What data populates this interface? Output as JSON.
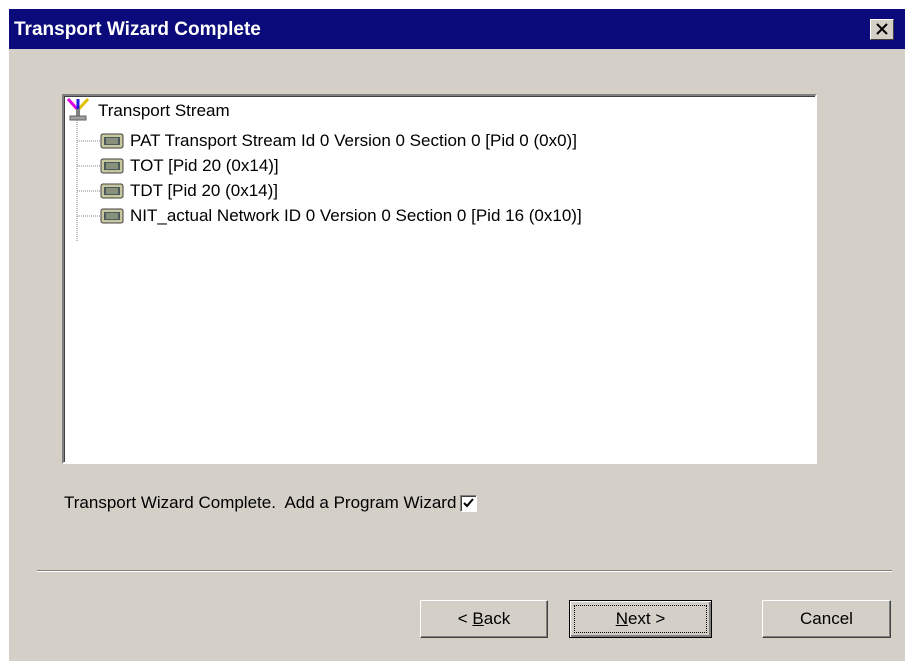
{
  "window": {
    "title": "Transport Wizard Complete",
    "title_bar_color": "#0a0a7a",
    "face_color": "#d4d0c8"
  },
  "tree": {
    "root": {
      "label": "Transport Stream",
      "icon": "antenna-icon"
    },
    "children": [
      {
        "label": "PAT Transport Stream Id 0 Version 0 Section 0 [Pid 0 (0x0)]",
        "icon": "table-icon"
      },
      {
        "label": "TOT [Pid 20 (0x14)]",
        "icon": "table-icon"
      },
      {
        "label": "TDT [Pid 20 (0x14)]",
        "icon": "table-icon"
      },
      {
        "label": "NIT_actual Network ID 0 Version 0 Section 0 [Pid 16 (0x10)]",
        "icon": "table-icon"
      }
    ]
  },
  "status": {
    "text": "Transport Wizard Complete.  Add a Program Wizard",
    "add_program_wizard_checked": true
  },
  "buttons": {
    "back": {
      "prefix": "< ",
      "accel": "B",
      "rest": "ack"
    },
    "next": {
      "accel": "N",
      "rest": "ext >"
    },
    "cancel": "Cancel"
  }
}
